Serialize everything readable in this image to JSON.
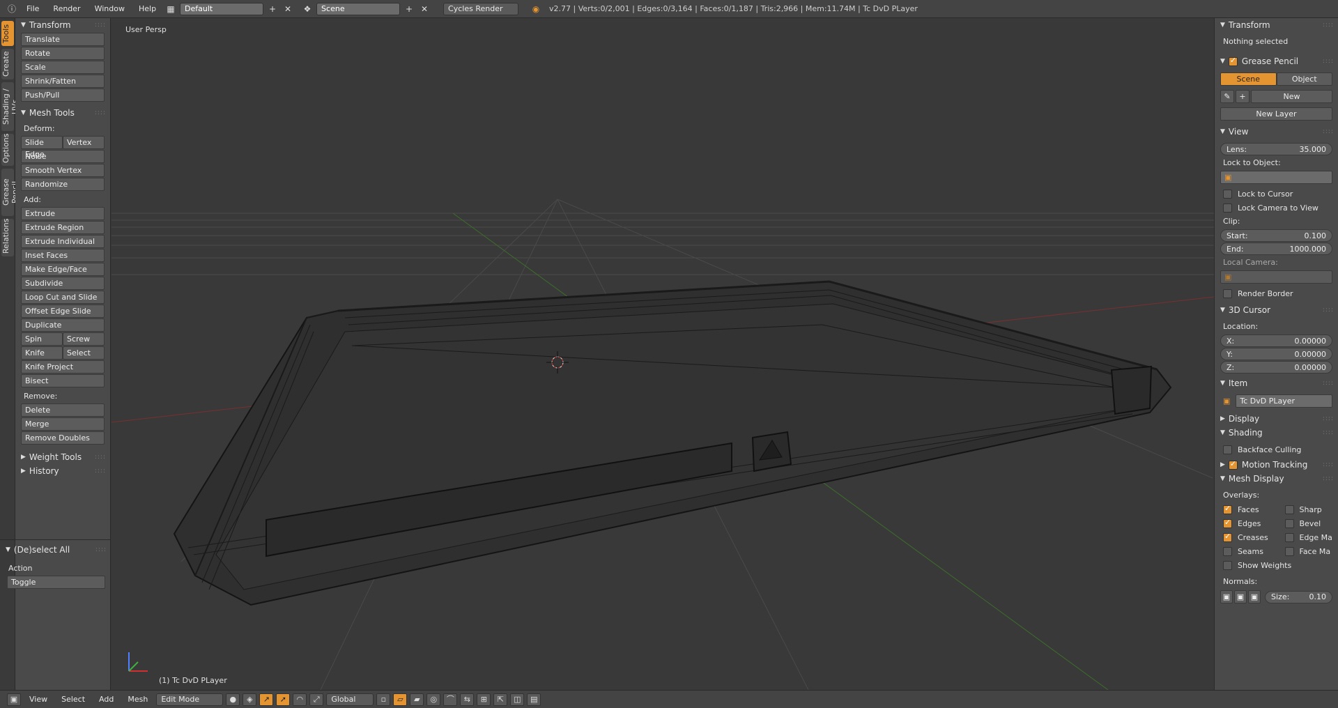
{
  "header": {
    "menus": [
      "File",
      "Render",
      "Window",
      "Help"
    ],
    "screen_layout": "Default",
    "scene": "Scene",
    "render_engine": "Cycles Render",
    "stats": "v2.77 | Verts:0/2,001 | Edges:0/3,164 | Faces:0/1,187 | Tris:2,966 | Mem:11.74M | Tc DvD PLayer"
  },
  "tabs": [
    "Tools",
    "Create",
    "Shading / UVs",
    "Options",
    "Grease Pencil",
    "Relations"
  ],
  "toolpanel": {
    "transform_title": "Transform",
    "transform_items": [
      "Translate",
      "Rotate",
      "Scale",
      "Shrink/Fatten",
      "Push/Pull"
    ],
    "mesh_tools_title": "Mesh Tools",
    "deform_label": "Deform:",
    "slide_edge": "Slide Edge",
    "vertex": "Vertex",
    "deform_items": [
      "Noise",
      "Smooth Vertex",
      "Randomize"
    ],
    "add_label": "Add:",
    "extrude": "Extrude",
    "add_items": [
      "Extrude Region",
      "Extrude Individual",
      "Inset Faces",
      "Make Edge/Face",
      "Subdivide",
      "Loop Cut and Slide",
      "Offset Edge Slide",
      "Duplicate"
    ],
    "spin": "Spin",
    "screw": "Screw",
    "knife": "Knife",
    "select": "Select",
    "knife_project": "Knife Project",
    "bisect": "Bisect",
    "remove_label": "Remove:",
    "delete": "Delete",
    "merge": "Merge",
    "remove_doubles": "Remove Doubles",
    "weight_tools": "Weight Tools",
    "history": "History",
    "deselect_title": "(De)select All",
    "action_label": "Action",
    "action_value": "Toggle"
  },
  "viewport": {
    "view_label": "User Persp",
    "object_label": "(1) Tc DvD PLayer"
  },
  "rightpanel": {
    "transform_title": "Transform",
    "nothing_selected": "Nothing selected",
    "grease_pencil_title": "Grease Pencil",
    "scene_btn": "Scene",
    "object_btn": "Object",
    "new_btn": "New",
    "new_layer_btn": "New Layer",
    "view_title": "View",
    "lens_label": "Lens:",
    "lens_value": "35.000",
    "lock_to_object": "Lock to Object:",
    "lock_to_cursor": "Lock to Cursor",
    "lock_camera": "Lock Camera to View",
    "clip_label": "Clip:",
    "clip_start_label": "Start:",
    "clip_start_value": "0.100",
    "clip_end_label": "End:",
    "clip_end_value": "1000.000",
    "local_camera": "Local Camera:",
    "render_border": "Render Border",
    "cursor_title": "3D Cursor",
    "location_label": "Location:",
    "x_label": "X:",
    "x_value": "0.00000",
    "y_label": "Y:",
    "y_value": "0.00000",
    "z_label": "Z:",
    "z_value": "0.00000",
    "item_title": "Item",
    "item_name": "Tc DvD PLayer",
    "display_title": "Display",
    "shading_title": "Shading",
    "backface_culling": "Backface Culling",
    "motion_tracking": "Motion Tracking",
    "mesh_display_title": "Mesh Display",
    "overlays_label": "Overlays:",
    "faces": "Faces",
    "sharp": "Sharp",
    "edges": "Edges",
    "bevel": "Bevel",
    "creases": "Creases",
    "edge_ma": "Edge Ma",
    "seams": "Seams",
    "face_ma": "Face Ma",
    "show_weights": "Show Weights",
    "normals_label": "Normals:",
    "size_label": "Size:",
    "size_value": "0.10"
  },
  "bottombar": {
    "menus": [
      "View",
      "Select",
      "Add",
      "Mesh"
    ],
    "mode": "Edit Mode",
    "orientation": "Global"
  },
  "colors": {
    "accent": "#e59432",
    "panel": "#4a4a4a",
    "viewport": "#393939"
  }
}
